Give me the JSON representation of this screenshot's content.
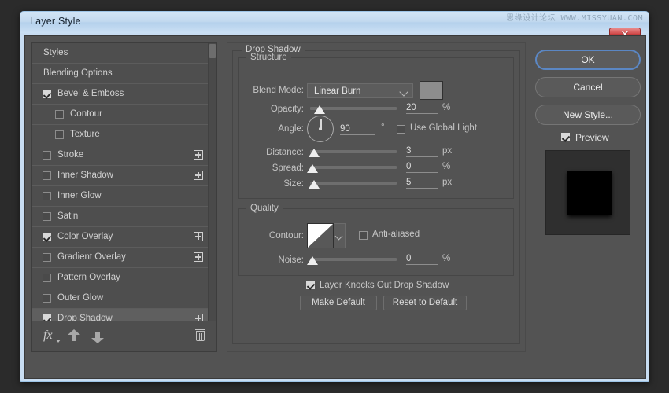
{
  "window": {
    "title": "Layer Style",
    "watermark": "思缘设计论坛 WWW.MISSYUAN.COM",
    "close_glyph": "✕"
  },
  "styles_panel": {
    "items": [
      {
        "label": "Styles",
        "checkbox": "none",
        "indent": false,
        "plus": false,
        "selected": false
      },
      {
        "label": "Blending Options",
        "checkbox": "none",
        "indent": false,
        "plus": false,
        "selected": false
      },
      {
        "label": "Bevel & Emboss",
        "checkbox": "checked",
        "indent": false,
        "plus": false,
        "selected": false
      },
      {
        "label": "Contour",
        "checkbox": "unchecked",
        "indent": true,
        "plus": false,
        "selected": false
      },
      {
        "label": "Texture",
        "checkbox": "unchecked",
        "indent": true,
        "plus": false,
        "selected": false
      },
      {
        "label": "Stroke",
        "checkbox": "unchecked",
        "indent": false,
        "plus": true,
        "selected": false
      },
      {
        "label": "Inner Shadow",
        "checkbox": "unchecked",
        "indent": false,
        "plus": true,
        "selected": false
      },
      {
        "label": "Inner Glow",
        "checkbox": "unchecked",
        "indent": false,
        "plus": false,
        "selected": false
      },
      {
        "label": "Satin",
        "checkbox": "unchecked",
        "indent": false,
        "plus": false,
        "selected": false
      },
      {
        "label": "Color Overlay",
        "checkbox": "checked",
        "indent": false,
        "plus": true,
        "selected": false
      },
      {
        "label": "Gradient Overlay",
        "checkbox": "unchecked",
        "indent": false,
        "plus": true,
        "selected": false
      },
      {
        "label": "Pattern Overlay",
        "checkbox": "unchecked",
        "indent": false,
        "plus": false,
        "selected": false
      },
      {
        "label": "Outer Glow",
        "checkbox": "unchecked",
        "indent": false,
        "plus": false,
        "selected": false
      },
      {
        "label": "Drop Shadow",
        "checkbox": "checked",
        "indent": false,
        "plus": true,
        "selected": true
      }
    ],
    "footer": {
      "fx_label": "fx",
      "move_up_icon": "arrow-up-icon",
      "move_down_icon": "arrow-down-icon",
      "delete_icon": "trash-icon"
    }
  },
  "settings": {
    "section_title": "Drop Shadow",
    "structure": {
      "title": "Structure",
      "blend_mode_label": "Blend Mode:",
      "blend_mode_value": "Linear Burn",
      "shadow_color": "#8d8d8d",
      "opacity_label": "Opacity:",
      "opacity_value": "20",
      "opacity_unit": "%",
      "angle_label": "Angle:",
      "angle_value": "90",
      "angle_unit": "°",
      "use_global_light_label": "Use Global Light",
      "use_global_light_checked": false,
      "distance_label": "Distance:",
      "distance_value": "3",
      "distance_unit": "px",
      "spread_label": "Spread:",
      "spread_value": "0",
      "spread_unit": "%",
      "size_label": "Size:",
      "size_value": "5",
      "size_unit": "px"
    },
    "quality": {
      "title": "Quality",
      "contour_label": "Contour:",
      "anti_aliased_label": "Anti-aliased",
      "anti_aliased_checked": false,
      "noise_label": "Noise:",
      "noise_value": "0",
      "noise_unit": "%"
    },
    "knockout_label": "Layer Knocks Out Drop Shadow",
    "knockout_checked": true,
    "make_default_label": "Make Default",
    "reset_default_label": "Reset to Default"
  },
  "actions": {
    "ok_label": "OK",
    "cancel_label": "Cancel",
    "new_style_label": "New Style...",
    "preview_label": "Preview",
    "preview_checked": true
  }
}
